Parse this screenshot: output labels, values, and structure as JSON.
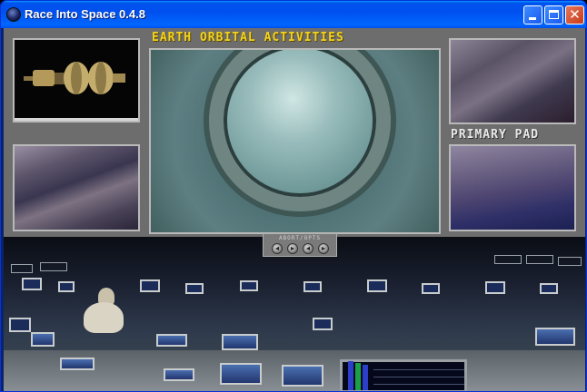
{
  "window": {
    "title": "Race Into Space 0.4.8",
    "icon": "app-globe-icon",
    "controls": [
      "minimize-icon",
      "maximize-icon",
      "close-icon"
    ],
    "close_glyph": "✕"
  },
  "game": {
    "panel_title": "EARTH ORBITAL ACTIVITIES",
    "side_label": "PRIMARY PAD",
    "control_label": "ABORT/OPTS",
    "control_buttons": [
      "◂",
      "▸",
      "◂",
      "▸"
    ]
  },
  "colors": {
    "title_yellow": "#f4d21c",
    "label_white": "#e8e8e8",
    "panel_gray": "#6d6d6d",
    "titlebar_blue": "#0053ee"
  }
}
